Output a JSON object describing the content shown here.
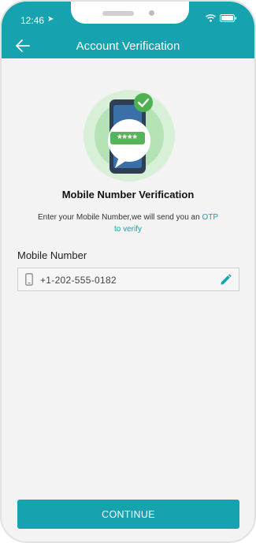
{
  "status_bar": {
    "time": "12:46",
    "location_icon": "location-arrow-icon",
    "wifi_icon": "wifi-icon",
    "battery_icon": "battery-icon"
  },
  "app_bar": {
    "title": "Account Verification",
    "back_icon": "back-arrow-icon"
  },
  "illustration": {
    "otp_mask": "****",
    "check_icon": "check-icon"
  },
  "content": {
    "heading": "Mobile Number  Verification",
    "description_prefix": "Enter your Mobile Number,we will send you an",
    "description_accent_1": "OTP",
    "description_accent_2": "to verify"
  },
  "form": {
    "label": "Mobile Number",
    "phone_value": "+1-202-555-0182",
    "device_icon": "mobile-phone-icon",
    "edit_icon": "edit-pencil-icon"
  },
  "actions": {
    "continue_label": "CONTINUE"
  },
  "colors": {
    "primary": "#17a2b0",
    "success": "#4caf50",
    "background": "#f3f3f3"
  }
}
